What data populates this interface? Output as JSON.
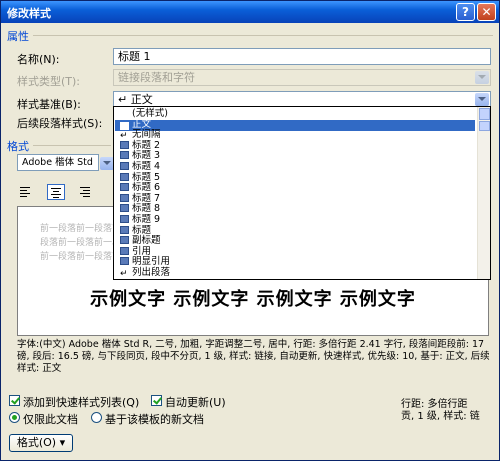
{
  "window": {
    "title": "修改样式",
    "help": "?",
    "close": "✕"
  },
  "properties": {
    "section": "属性",
    "name_label": "名称(N):",
    "name_value": "标题 1",
    "type_label": "样式类型(T):",
    "type_value": "链接段落和字符",
    "base_label": "样式基准(B):",
    "base_value": "↵ 正文",
    "next_label": "后续段落样式(S):"
  },
  "format": {
    "section": "格式",
    "font_value": "Adobe 楷体 Std",
    "dropdown_items": [
      "(无样式)",
      "正文",
      "无间隔",
      "标题 2",
      "标题 3",
      "标题 4",
      "标题 5",
      "标题 6",
      "标题 7",
      "标题 8",
      "标题 9",
      "标题",
      "副标题",
      "引用",
      "明显引用",
      "列出段落"
    ],
    "dropdown_icons": [
      "none",
      "para",
      "para",
      "lnk",
      "lnk",
      "lnk",
      "lnk",
      "lnk",
      "lnk",
      "lnk",
      "lnk",
      "lnk",
      "lnk",
      "lnk",
      "lnk",
      "para"
    ],
    "selected_index": 1
  },
  "preview": {
    "prev_lines": [
      "前一段落前一段落前一段落前一段落前一段落前一段落前一段落前一段落前一段落",
      "段落前一段落前一段落前一段落前一段落前一段落前一段落前一段落前一段落",
      "前一段落前一段落前一段落前一段落前一段落前一段落前一段落前一段落"
    ],
    "sample": "示例文字 示例文字 示例文字 示例文字"
  },
  "description": "字体:(中文) Adobe 楷体 Std R, 二号, 加粗, 字距调整二号, 居中, 行距: 多倍行距 2.41 字行, 段落间距段前: 17 磅, 段后: 16.5 磅, 与下段同页, 段中不分页, 1 级, 样式: 链接, 自动更新, 快速样式, 优先级: 10, 基于: 正文, 后续样式: 正文",
  "options": {
    "add_quick": "添加到快速样式列表(Q)",
    "auto_update": "自动更新(U)",
    "only_doc": "仅限此文档",
    "new_template": "基于该模板的新文档"
  },
  "status_right": {
    "line1": "行距: 多倍行距",
    "line2": "贡, 1 级, 样式: 链"
  },
  "buttons": {
    "format": "格式(O) ▾"
  }
}
